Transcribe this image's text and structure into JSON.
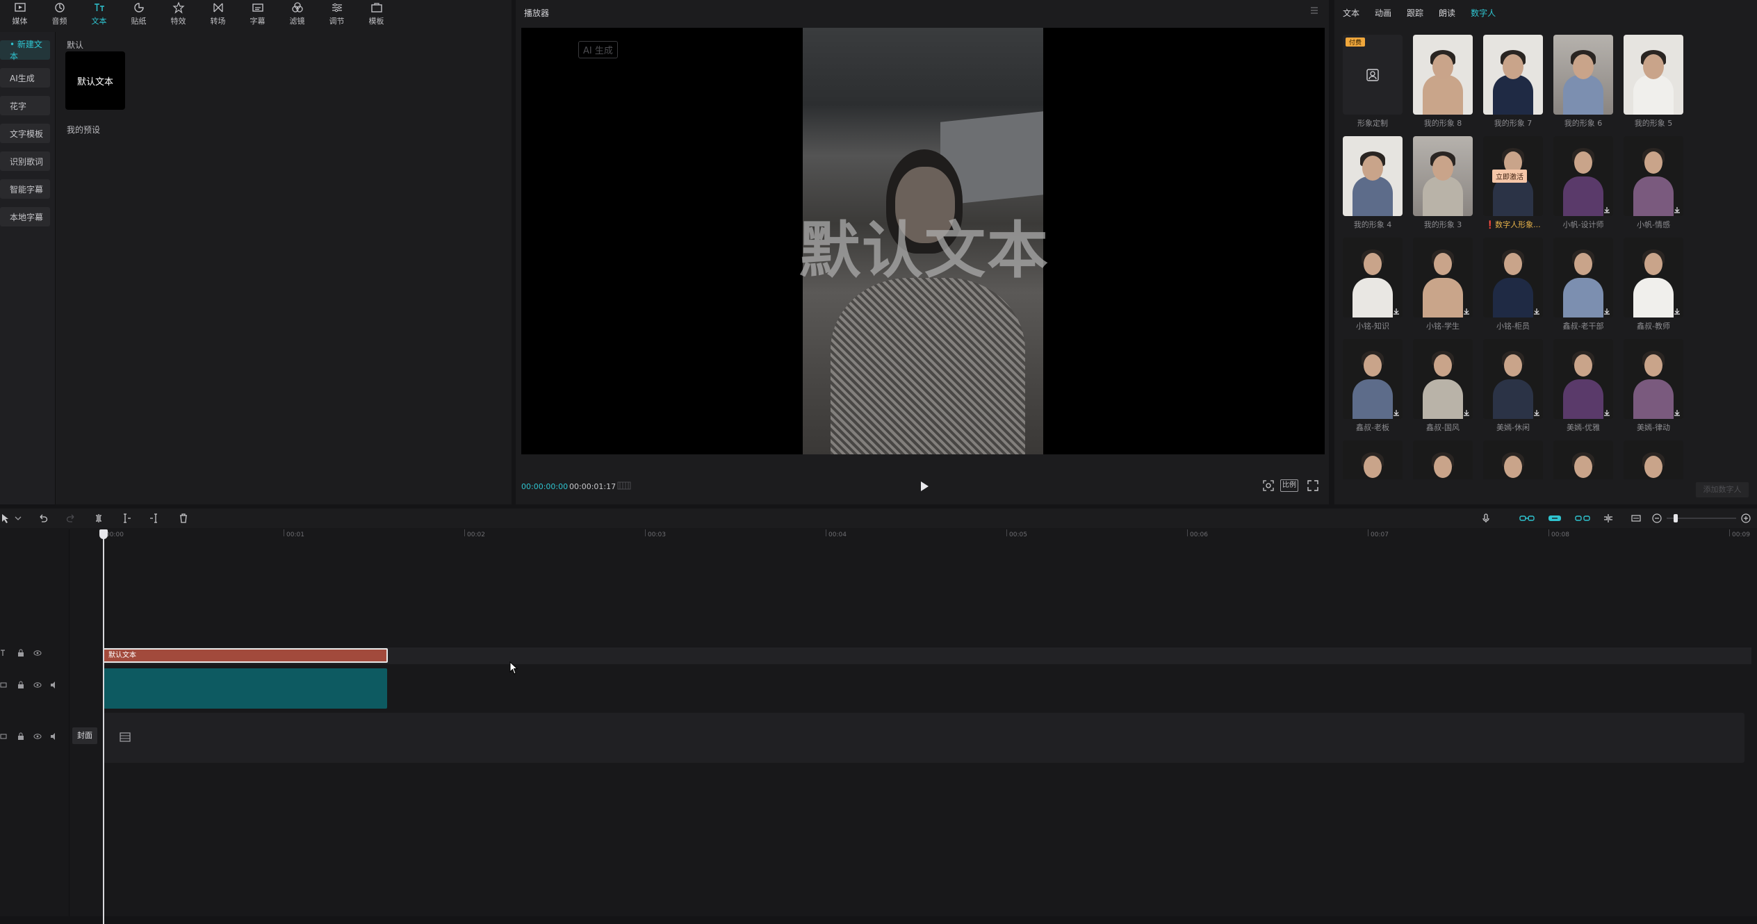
{
  "toolbar": {
    "items": [
      {
        "label": "媒体",
        "icon": "media-icon"
      },
      {
        "label": "音频",
        "icon": "audio-icon"
      },
      {
        "label": "文本",
        "icon": "text-icon",
        "active": true
      },
      {
        "label": "贴纸",
        "icon": "sticker-icon"
      },
      {
        "label": "特效",
        "icon": "effects-icon"
      },
      {
        "label": "转场",
        "icon": "transition-icon"
      },
      {
        "label": "字幕",
        "icon": "caption-icon"
      },
      {
        "label": "滤镜",
        "icon": "filter-icon"
      },
      {
        "label": "调节",
        "icon": "adjust-icon"
      },
      {
        "label": "模板",
        "icon": "template-icon"
      }
    ]
  },
  "side_nav": {
    "items": [
      {
        "label": "• 新建文本",
        "active": true
      },
      {
        "label": "AI生成"
      },
      {
        "label": "花字"
      },
      {
        "label": "文字模板"
      },
      {
        "label": "识别歌词"
      },
      {
        "label": "智能字幕"
      },
      {
        "label": "本地字幕"
      }
    ]
  },
  "left_content": {
    "section_default": "默认",
    "preset_card_label": "默认文本",
    "section_my_presets": "我的预设"
  },
  "player": {
    "title": "播放器",
    "ai_badge": "AI 生成",
    "overlay_text": "默认文本",
    "time_current": "00:00:00:00",
    "time_total": "00:00:01:17",
    "ratio_label": "比例"
  },
  "right_panel": {
    "tabs": [
      {
        "label": "文本"
      },
      {
        "label": "动画"
      },
      {
        "label": "跟踪"
      },
      {
        "label": "朗读"
      },
      {
        "label": "数字人",
        "active": true
      }
    ],
    "avatars": [
      {
        "name": "形象定制",
        "style": "blank",
        "paid": "付费"
      },
      {
        "name": "我的形象 8",
        "style": "light"
      },
      {
        "name": "我的形象 7",
        "style": "light"
      },
      {
        "name": "我的形象 6",
        "style": "office"
      },
      {
        "name": "我的形象 5",
        "style": "light"
      },
      {
        "name": "我的形象 4",
        "style": "light"
      },
      {
        "name": "我的形象 3",
        "style": "office"
      },
      {
        "name": "数字人形象...",
        "style": "dark",
        "warn": true,
        "activate": "立即激活"
      },
      {
        "name": "小帆-设计师",
        "style": "dark",
        "download": true
      },
      {
        "name": "小帆-情感",
        "style": "dark",
        "download": true
      },
      {
        "name": "小铭-知识",
        "style": "dark",
        "download": true
      },
      {
        "name": "小铭-学生",
        "style": "dark",
        "download": true
      },
      {
        "name": "小铭-柜员",
        "style": "dark",
        "download": true
      },
      {
        "name": "鑫叔-老干部",
        "style": "dark",
        "download": true
      },
      {
        "name": "鑫叔-教师",
        "style": "dark",
        "download": true
      },
      {
        "name": "鑫叔-老板",
        "style": "dark",
        "download": true
      },
      {
        "name": "鑫叔-国风",
        "style": "dark",
        "download": true
      },
      {
        "name": "美嫣-休闲",
        "style": "dark",
        "download": true
      },
      {
        "name": "美嫣-优雅",
        "style": "dark",
        "download": true
      },
      {
        "name": "美嫣-律动",
        "style": "dark",
        "download": true
      },
      {
        "name": "",
        "style": "dark"
      },
      {
        "name": "",
        "style": "dark"
      },
      {
        "name": "",
        "style": "dark"
      },
      {
        "name": "",
        "style": "dark"
      },
      {
        "name": "",
        "style": "dark"
      }
    ],
    "add_button": "添加数字人"
  },
  "timeline": {
    "ruler": [
      "00:00",
      "00:01",
      "00:02",
      "00:03",
      "00:04",
      "00:05",
      "00:06",
      "00:07",
      "00:08",
      "00:09"
    ],
    "text_clip_label": "默认文本",
    "cover_label": "封面"
  },
  "colors": {
    "accent": "#2fc4d0",
    "text_clip": "#a24a3c",
    "video_clip": "#0d5a61"
  }
}
